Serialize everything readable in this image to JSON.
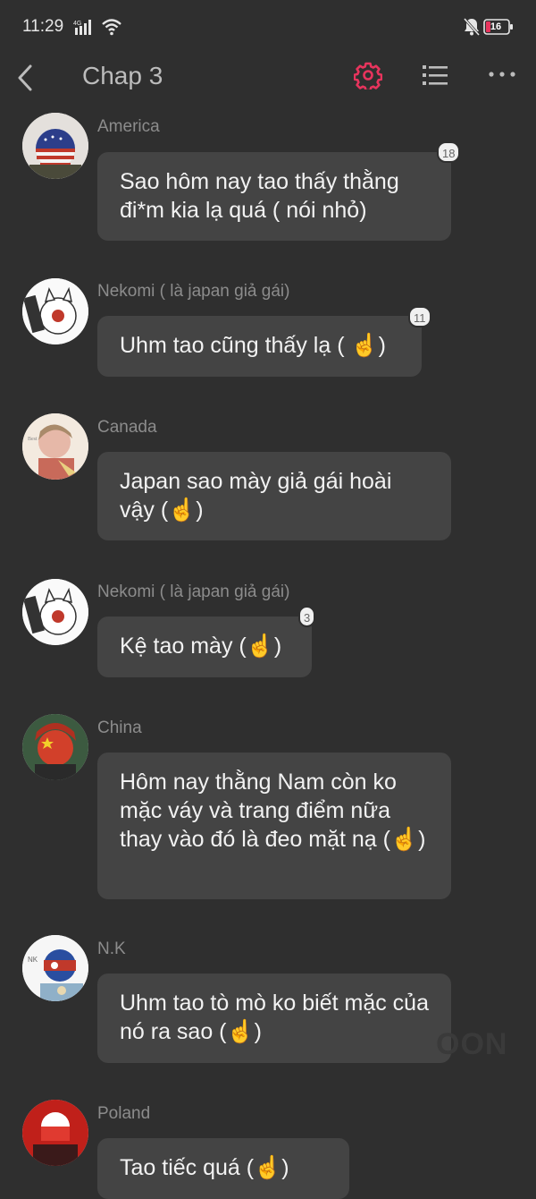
{
  "status_bar": {
    "time": "11:29",
    "network": "4G",
    "battery": "16"
  },
  "header": {
    "title": "Chap 3",
    "accent_color": "#e8345d"
  },
  "messages": [
    {
      "name": "America",
      "text": "Sao hôm nay tao thấy thằng đi*m kia lạ quá ( nói nhỏ)",
      "badge": "18"
    },
    {
      "name": "Nekomi ( là japan giả gái)",
      "text": "Uhm tao cũng thấy lạ ( ☝️)",
      "badge": "11"
    },
    {
      "name": "Canada",
      "text": "Japan sao mày giả gái hoài vậy (☝️)",
      "badge": ""
    },
    {
      "name": "Nekomi ( là japan giả gái)",
      "text": "Kệ tao mày (☝️)",
      "badge": "3"
    },
    {
      "name": "China",
      "text": "Hôm nay thằng Nam còn ko mặc váy và trang điểm nữa thay vào đó là đeo mặt nạ (☝️)",
      "badge": ""
    },
    {
      "name": "N.K",
      "text": "Uhm tao tò mò ko biết mặc của nó ra sao (☝️)",
      "badge": ""
    },
    {
      "name": "Poland",
      "text": "Tao tiếc quá (☝️)",
      "badge": ""
    }
  ],
  "watermark": "OON"
}
